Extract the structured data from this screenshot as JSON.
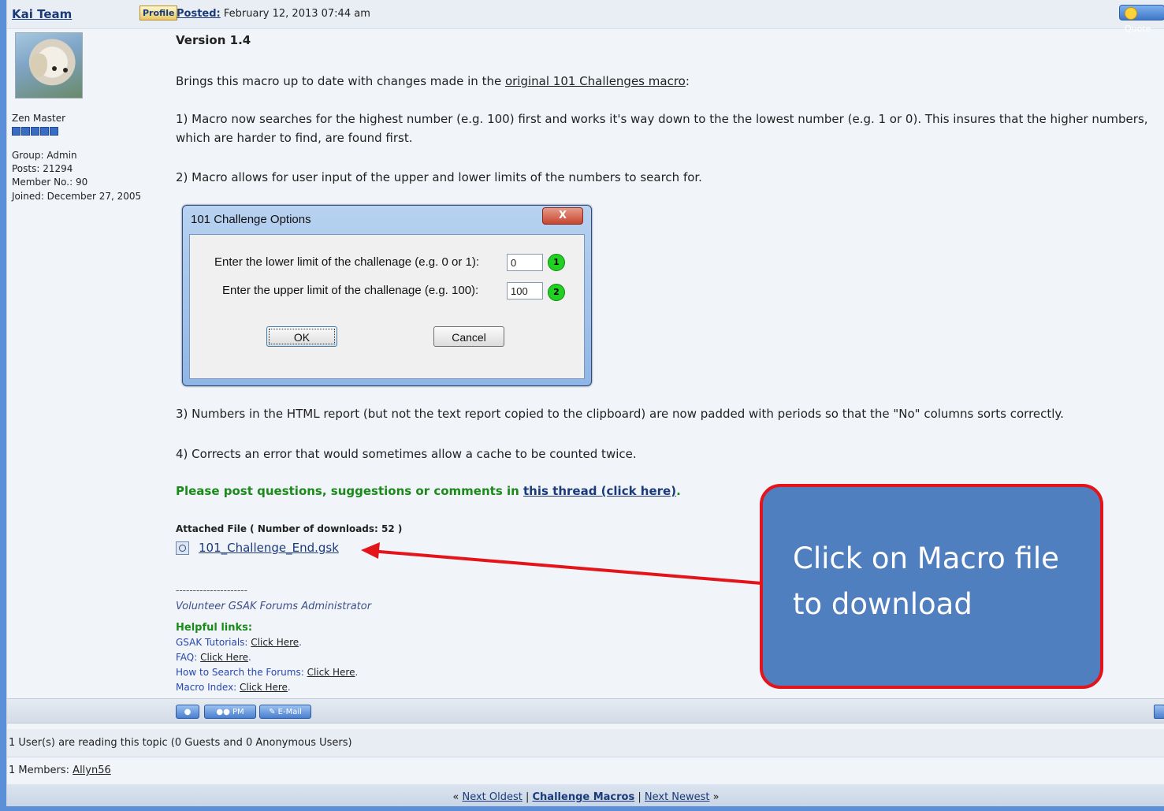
{
  "post": {
    "author": "Kai Team",
    "profile_label": "Profile",
    "posted_label": "Posted:",
    "posted_date": "February 12, 2013 07:44 am",
    "quote_label": "Quote"
  },
  "user": {
    "rank": "Zen Master",
    "group": "Group: Admin",
    "posts": "Posts: 21294",
    "member_no": "Member No.: 90",
    "joined": "Joined: December 27, 2005"
  },
  "content": {
    "version": "Version 1.4",
    "intro_prefix": "Brings this macro up to date with changes made in the ",
    "intro_link": "original 101 Challenges macro",
    "intro_suffix": ":",
    "item1": "1) Macro now searches for the highest number (e.g. 100) first and works it's way down to the the lowest number (e.g. 1 or 0). This insures that the higher numbers, which are harder to find, are found first.",
    "item2": "2) Macro allows for user input of the upper and lower limits of the numbers to search for.",
    "item3": "3) Numbers in the HTML report (but not the text report copied to the clipboard) are now padded with periods so that the \"No\" columns sorts correctly.",
    "item4": "4) Corrects an error that would sometimes allow a cache to be counted twice.",
    "questions_text": "Please post questions, suggestions or comments in ",
    "questions_link": "this thread (click here)",
    "questions_end": "."
  },
  "dialog": {
    "title": "101 Challenge Options",
    "close_label": "X",
    "lower_label": "Enter the lower limit of the challenage (e.g. 0 or 1):",
    "lower_value": "0",
    "upper_label": "Enter the upper limit of the challenage (e.g. 100):",
    "upper_value": "100",
    "badge1": "1",
    "badge2": "2",
    "ok_label": "OK",
    "cancel_label": "Cancel"
  },
  "attachment": {
    "title": "Attached File ( Number of downloads: 52 )",
    "file_name": "101_Challenge_End.gsk"
  },
  "signature": {
    "line": "---------------------",
    "admin": "Volunteer GSAK Forums Administrator",
    "helpful": "Helpful links:",
    "links": [
      {
        "label": "GSAK Tutorials:",
        "link": "Click Here"
      },
      {
        "label": "FAQ:",
        "link": "Click Here"
      },
      {
        "label": "How to Search the Forums:",
        "link": "Click Here"
      },
      {
        "label": "Macro Index:",
        "link": "Click Here"
      }
    ]
  },
  "actions": {
    "pm_label": "PM",
    "email_label": "E-Mail"
  },
  "footer": {
    "reading": "1 User(s) are reading this topic (0 Guests and 0 Anonymous Users)",
    "members_prefix": "1 Members: ",
    "member_name": "Allyn56",
    "prev": "Next Oldest",
    "forum": "Challenge Macros",
    "next": "Next Newest"
  },
  "callout": {
    "text": "Click on Macro file to download"
  },
  "colors": {
    "callout_fill": "#4f7fbf",
    "callout_border": "#e4141b",
    "arrow": "#e4141b",
    "badge": "#22d022"
  }
}
